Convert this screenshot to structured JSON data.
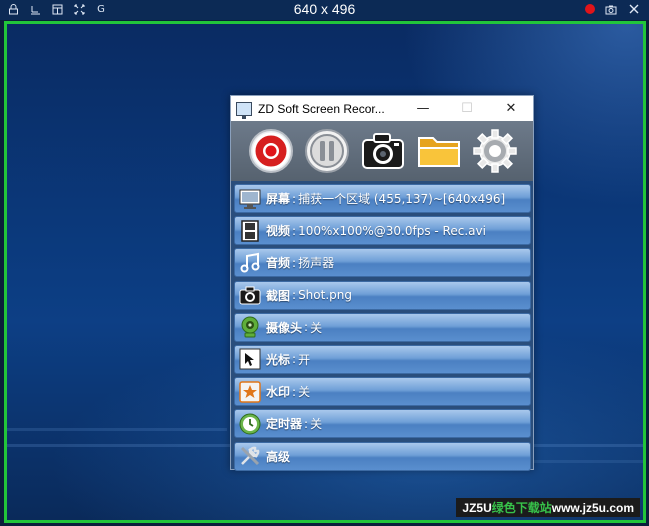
{
  "topbar": {
    "dimension": "640 x 496",
    "left_icons": [
      "lock-icon",
      "dock-icon",
      "layout-icon",
      "fullscreen-icon",
      "grid-icon"
    ],
    "right_icons": [
      "record-dot-icon",
      "camera-icon",
      "close-icon"
    ],
    "grid_label": "G"
  },
  "window": {
    "title": "ZD Soft Screen Recor...",
    "minimize": "—",
    "maximize": "☐",
    "close": "✕"
  },
  "toolbar": {
    "buttons": [
      "record-button",
      "pause-button",
      "screenshot-button",
      "open-folder-button",
      "settings-button"
    ]
  },
  "rows": [
    {
      "label": "屏幕",
      "value": "捕获一个区域 (455,137)~[640x496]",
      "icon": "monitor-icon"
    },
    {
      "label": "视频",
      "value": "100%x100%@30.0fps - Rec.avi",
      "icon": "film-icon"
    },
    {
      "label": "音频",
      "value": "扬声器",
      "icon": "music-note-icon"
    },
    {
      "label": "截图",
      "value": "Shot.png",
      "icon": "camera-icon"
    },
    {
      "label": "摄像头",
      "value": "关",
      "icon": "webcam-icon"
    },
    {
      "label": "光标",
      "value": "开",
      "icon": "cursor-icon"
    },
    {
      "label": "水印",
      "value": "关",
      "icon": "star-icon"
    },
    {
      "label": "定时器",
      "value": "关",
      "icon": "clock-icon"
    },
    {
      "label": "高级",
      "value": "",
      "icon": "tools-icon"
    }
  ],
  "separator": ":",
  "watermark": {
    "part1": "JZ5U",
    "part2": "绿色下载站",
    "part3": "www.jz5u.com"
  },
  "colors": {
    "border": "#22c53a",
    "record": "#e0141a",
    "row": "#5a8fcf"
  }
}
